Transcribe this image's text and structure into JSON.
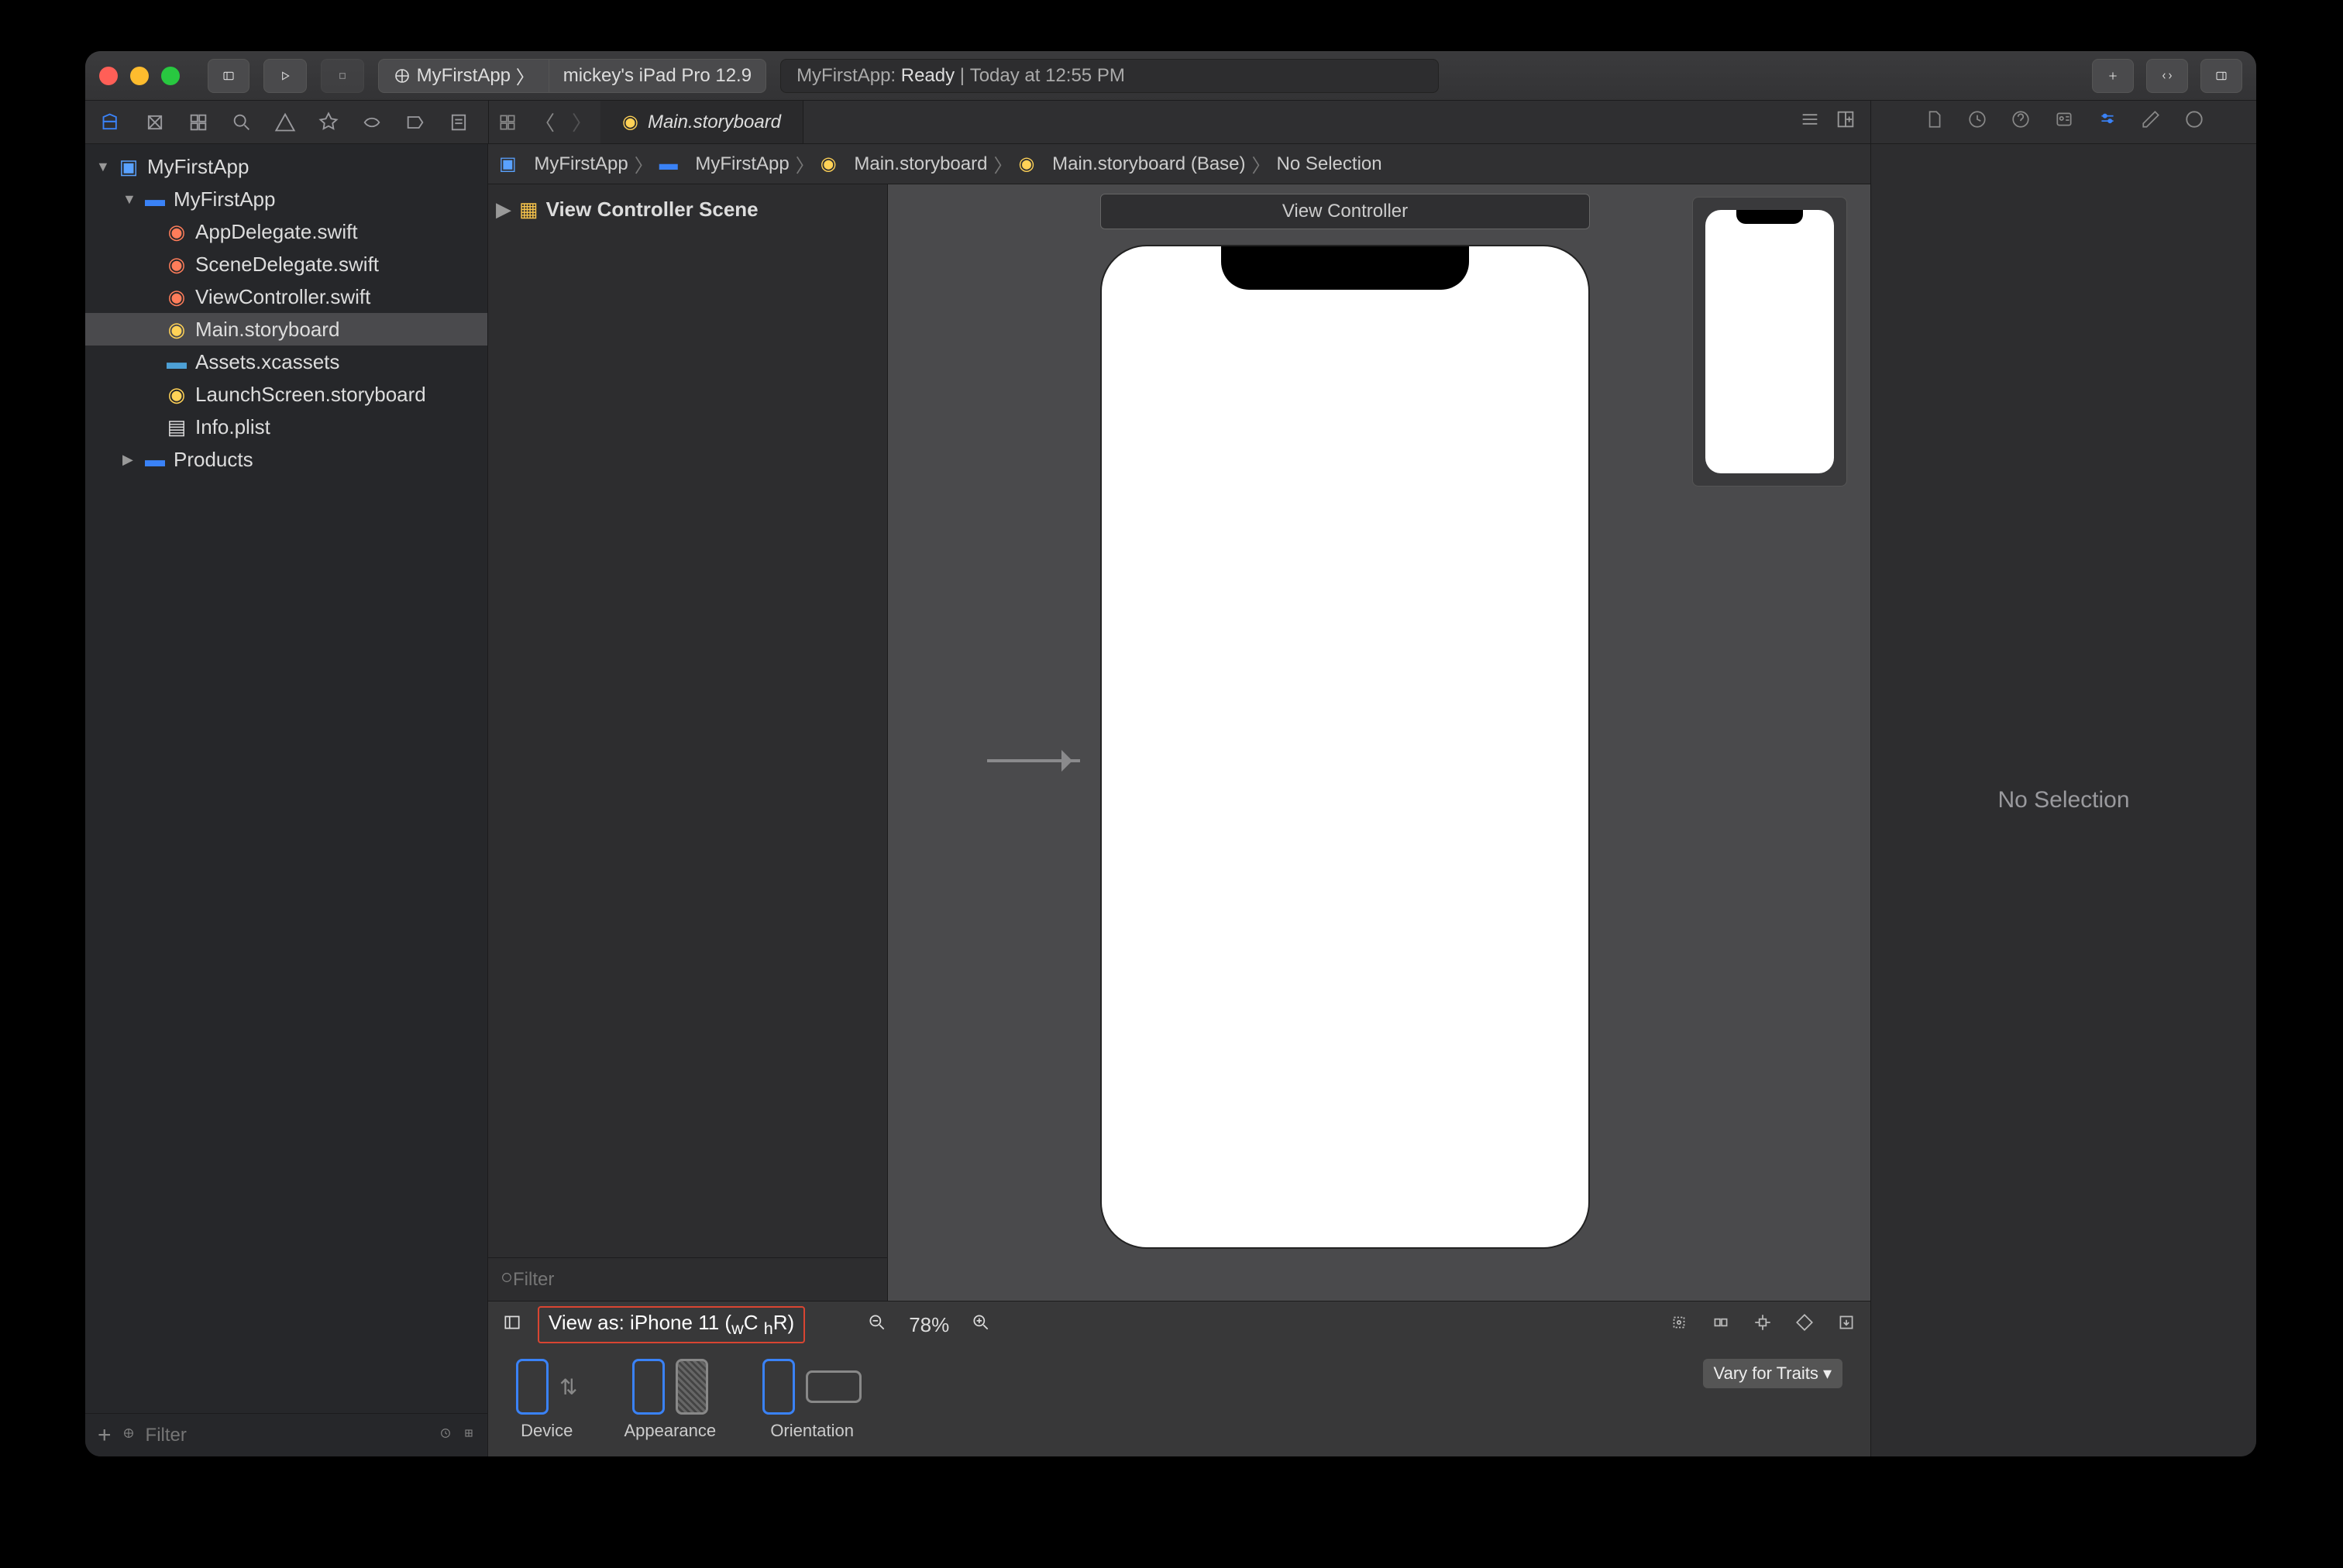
{
  "toolbar": {
    "scheme_app": "MyFirstApp",
    "scheme_device": "mickey's iPad Pro 12.9",
    "activity_app": "MyFirstApp:",
    "activity_status": "Ready",
    "activity_time": "Today at 12:55 PM"
  },
  "editor": {
    "tab_file": "Main.storyboard"
  },
  "jumpbar": {
    "items": [
      "MyFirstApp",
      "MyFirstApp",
      "Main.storyboard",
      "Main.storyboard (Base)",
      "No Selection"
    ]
  },
  "navigator": {
    "project": "MyFirstApp",
    "target_folder": "MyFirstApp",
    "files": [
      "AppDelegate.swift",
      "SceneDelegate.swift",
      "ViewController.swift",
      "Main.storyboard",
      "Assets.xcassets",
      "LaunchScreen.storyboard",
      "Info.plist"
    ],
    "products": "Products",
    "filter_placeholder": "Filter"
  },
  "outline": {
    "scene": "View Controller Scene",
    "filter_placeholder": "Filter"
  },
  "canvas": {
    "vc_label": "View Controller",
    "view_as": "View as: iPhone 11 (",
    "view_as_wc": "w",
    "view_as_c": "C ",
    "view_as_hr": "h",
    "view_as_r": "R)",
    "zoom": "78%",
    "device_label": "Device",
    "appearance_label": "Appearance",
    "orientation_label": "Orientation",
    "vary_label": "Vary for Traits"
  },
  "inspector": {
    "empty": "No Selection"
  }
}
